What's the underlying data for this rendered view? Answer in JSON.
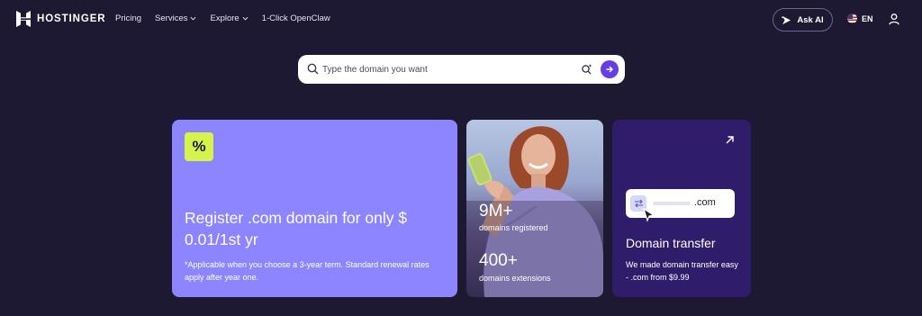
{
  "brand": {
    "name": "HOSTINGER"
  },
  "nav": {
    "links": [
      {
        "label": "Pricing",
        "has_dropdown": false
      },
      {
        "label": "Services",
        "has_dropdown": true
      },
      {
        "label": "Explore",
        "has_dropdown": true
      },
      {
        "label": "1-Click OpenClaw",
        "has_dropdown": false
      }
    ],
    "ask_ai_label": "Ask AI",
    "language": "EN",
    "icons": {
      "ask_ai": "sparkle-arrow-icon",
      "language": "us-flag-icon",
      "account": "user-icon"
    }
  },
  "search": {
    "placeholder": "Type the domain you want",
    "value": "",
    "icons": [
      "search-icon",
      "ai-sparkle-icon",
      "arrow-right-icon"
    ]
  },
  "promo_card": {
    "badge": "%",
    "title_line1": "Register .com domain for only $",
    "title_line2": "0.01/1st yr",
    "note": "*Applicable when you choose a 3-year term. Standard renewal rates apply after year one.",
    "colors": {
      "background": "#8c85ff",
      "badge": "#d5f34b"
    }
  },
  "stats_card": {
    "stats": [
      {
        "value": "9M+",
        "label": "domains registered"
      },
      {
        "value": "400+",
        "label": "domains extensions"
      }
    ]
  },
  "transfer_card": {
    "mock_tld": ".com",
    "title": "Domain transfer",
    "description": "We made domain transfer easy - .com from $9.99",
    "icons": [
      "arrow-up-right-icon",
      "swap-icon",
      "cursor-icon"
    ],
    "colors": {
      "background": "#2f1c6a"
    }
  },
  "colors": {
    "page_background": "#1d1932",
    "accent": "#673de6"
  }
}
